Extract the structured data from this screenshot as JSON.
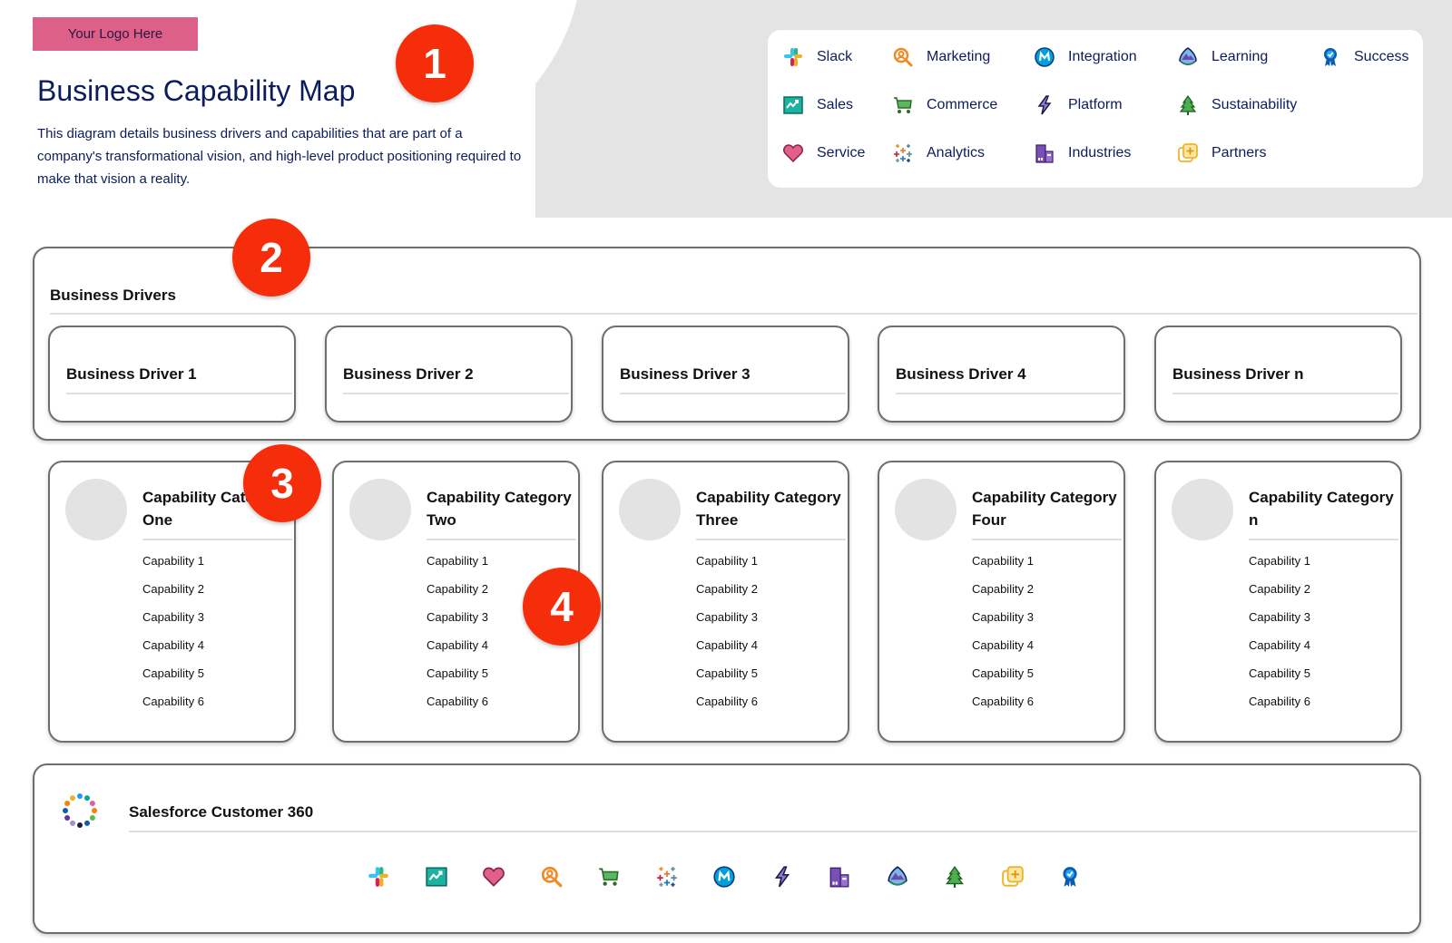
{
  "header": {
    "logo_text": "Your Logo Here",
    "title": "Business Capability Map",
    "description": "This diagram details business drivers and capabilities that are part of a company's transformational vision, and high-level product positioning required to make that vision a reality."
  },
  "badges": [
    "1",
    "2",
    "3",
    "4"
  ],
  "legend": {
    "items": [
      {
        "label": "Slack",
        "icon": "slack-icon"
      },
      {
        "label": "Marketing",
        "icon": "marketing-icon"
      },
      {
        "label": "Integration",
        "icon": "integration-icon"
      },
      {
        "label": "Learning",
        "icon": "learning-icon"
      },
      {
        "label": "Success",
        "icon": "success-icon"
      },
      {
        "label": "Sales",
        "icon": "sales-icon"
      },
      {
        "label": "Commerce",
        "icon": "commerce-icon"
      },
      {
        "label": "Platform",
        "icon": "platform-icon"
      },
      {
        "label": "Sustainability",
        "icon": "sustainability-icon"
      },
      {
        "label": "Service",
        "icon": "service-icon"
      },
      {
        "label": "Analytics",
        "icon": "analytics-icon"
      },
      {
        "label": "Industries",
        "icon": "industries-icon"
      },
      {
        "label": "Partners",
        "icon": "partners-icon"
      }
    ]
  },
  "business_drivers": {
    "title": "Business Drivers",
    "items": [
      "Business Driver 1",
      "Business Driver 2",
      "Business Driver 3",
      "Business Driver 4",
      "Business Driver n"
    ]
  },
  "capability_categories": [
    {
      "title": "Capability Category One",
      "capabilities": [
        "Capability 1",
        "Capability 2",
        "Capability 3",
        "Capability 4",
        "Capability 5",
        "Capability 6"
      ]
    },
    {
      "title": "Capability Category Two",
      "capabilities": [
        "Capability 1",
        "Capability 2",
        "Capability 3",
        "Capability 4",
        "Capability 5",
        "Capability 6"
      ]
    },
    {
      "title": "Capability Category Three",
      "capabilities": [
        "Capability 1",
        "Capability 2",
        "Capability 3",
        "Capability 4",
        "Capability 5",
        "Capability 6"
      ]
    },
    {
      "title": "Capability Category Four",
      "capabilities": [
        "Capability 1",
        "Capability 2",
        "Capability 3",
        "Capability 4",
        "Capability 5",
        "Capability 6"
      ]
    },
    {
      "title": "Capability Category n",
      "capabilities": [
        "Capability 1",
        "Capability 2",
        "Capability 3",
        "Capability 4",
        "Capability 5",
        "Capability 6"
      ]
    }
  ],
  "customer360": {
    "title": "Salesforce Customer 360",
    "products": [
      "slack-icon",
      "sales-icon",
      "service-icon",
      "marketing-icon",
      "commerce-icon",
      "analytics-icon",
      "integration-icon",
      "platform-icon",
      "industries-icon",
      "learning-icon",
      "sustainability-icon",
      "partners-icon",
      "success-icon"
    ]
  },
  "colors": {
    "badge": "#f52d0a",
    "logo_bg": "#dd6089",
    "title": "#0b1d5c",
    "panel_border": "#6e6e6e",
    "placeholder_circle": "#e3e3e3"
  }
}
